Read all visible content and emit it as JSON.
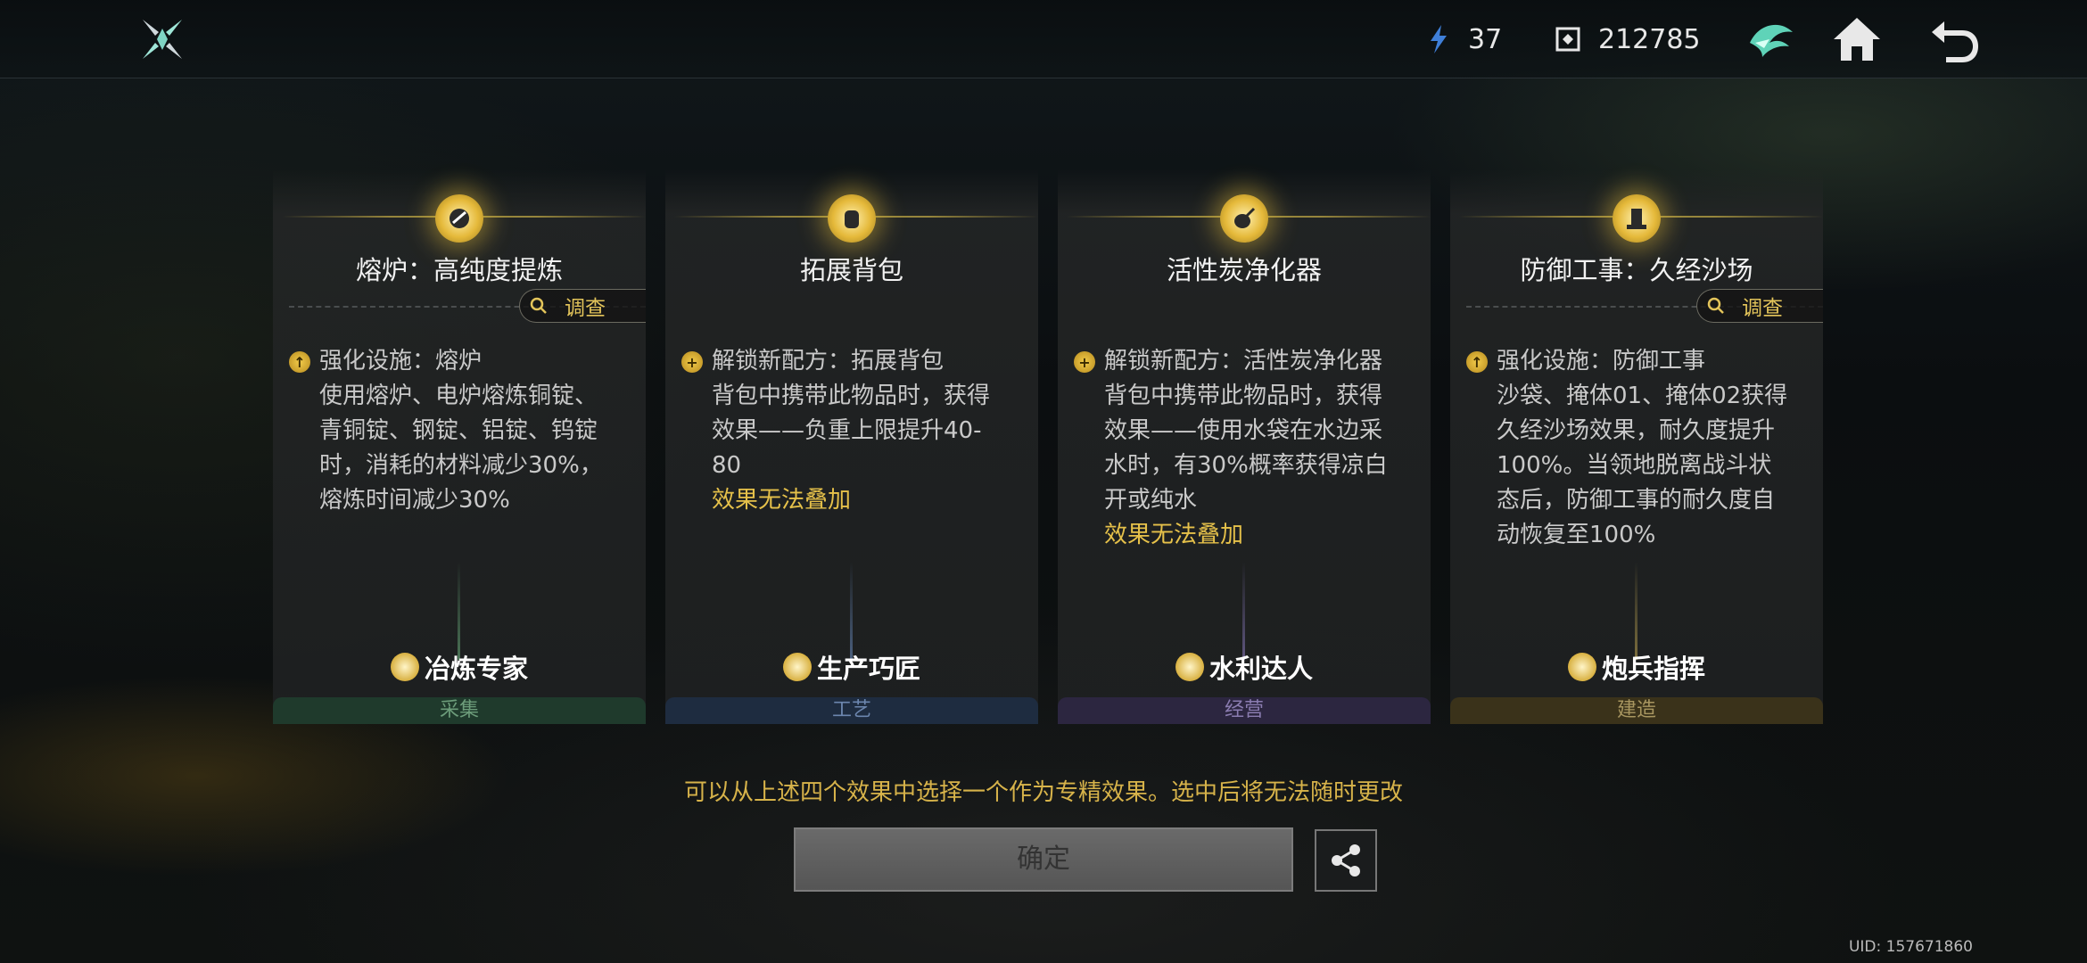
{
  "header": {
    "currency_1": {
      "icon": "energy-shard-icon",
      "value": "37"
    },
    "currency_2": {
      "icon": "crystal-cube-icon",
      "value": "212785"
    }
  },
  "cards": [
    {
      "title": "熔炉：高纯度提炼",
      "investigate_label": "调查",
      "lines": [
        "强化设施：熔炉",
        "使用熔炉、电炉熔炼铜锭、",
        "青铜锭、钢锭、铝锭、钨锭",
        "时，消耗的材料减少30%，",
        "熔炼时间减少30%"
      ],
      "note": "",
      "role": "冶炼专家",
      "category": "采集"
    },
    {
      "title": "拓展背包",
      "investigate_label": "",
      "lines": [
        "解锁新配方：拓展背包",
        "背包中携带此物品时，获得",
        "效果——负重上限提升40-",
        "80"
      ],
      "note": "效果无法叠加",
      "role": "生产巧匠",
      "category": "工艺"
    },
    {
      "title": "活性炭净化器",
      "investigate_label": "",
      "lines": [
        "解锁新配方：活性炭净化器",
        "背包中携带此物品时，获得",
        "效果——使用水袋在水边采",
        "水时，有30%概率获得凉白",
        "开或纯水"
      ],
      "note": "效果无法叠加",
      "role": "水利达人",
      "category": "经营"
    },
    {
      "title": "防御工事：久经沙场",
      "investigate_label": "调查",
      "lines": [
        "强化设施：防御工事",
        "沙袋、掩体01、掩体02获得",
        "久经沙场效果，耐久度提升",
        "100%。当领地脱离战斗状",
        "态后，防御工事的耐久度自",
        "动恢复至100%"
      ],
      "note": "",
      "role": "炮兵指挥",
      "category": "建造"
    }
  ],
  "hint": "可以从上述四个效果中选择一个作为专精效果。选中后将无法随时更改",
  "confirm_label": "确定",
  "uid": "UID: 157671860"
}
